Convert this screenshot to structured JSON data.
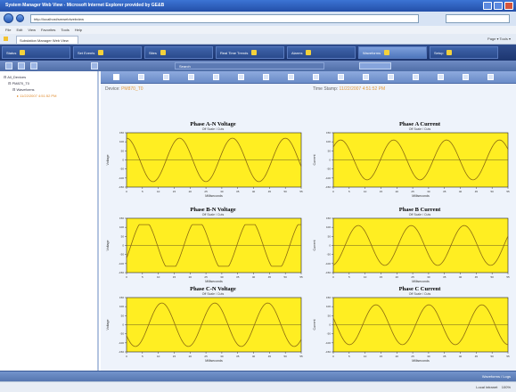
{
  "window": {
    "title": "System Manager Web View - Microsoft Internet Explorer provided by GE&B"
  },
  "browser": {
    "url": "http://localhost/smweb/webview",
    "menu": [
      "File",
      "Edit",
      "View",
      "Favorites",
      "Tools",
      "Help"
    ],
    "tab_title": "Substation Manager Web View",
    "command_labels": "Page ▾   Tools ▾",
    "status_text": "Local intranet",
    "zoom": "100%"
  },
  "app_nav": {
    "items": [
      {
        "label": "Status",
        "icon": "status-icon"
      },
      {
        "label": "Set Events",
        "icon": "event-icon"
      },
      {
        "label": "Sites",
        "icon": "sites-icon"
      },
      {
        "label": "Real Time Trends",
        "icon": "trend-icon"
      },
      {
        "label": "Alarms",
        "icon": "alarm-icon"
      },
      {
        "label": "Waveforms",
        "icon": "waveform-icon"
      },
      {
        "label": "Setup",
        "icon": "setup-icon"
      }
    ],
    "active": "Waveforms"
  },
  "toolbar": {
    "field_1": "Search"
  },
  "tree": {
    "nodes": [
      {
        "label": "All_Devices",
        "level": 0
      },
      {
        "label": "PM870_T0",
        "level": 1
      },
      {
        "label": "Waveforms",
        "level": 2
      },
      {
        "label": "11/22/2007 4:51:52 PM",
        "level": 3,
        "selected": true
      }
    ]
  },
  "main": {
    "device_label": "Device:",
    "device_value": "PM870_T0",
    "time_label": "Time Stamp:",
    "time_value": "11/22/2007 4:51:52 PM"
  },
  "status": {
    "right_text": "Waveforms / Logs"
  },
  "colors": {
    "plot_bg": "#ffee22",
    "wave": "#8a6a10",
    "nav_bg": "#1d3670",
    "accent": "#e39a3a"
  },
  "chart_data": [
    {
      "type": "line",
      "title": "Phase A-N Voltage",
      "subtitle": "Off Scale / Cuts",
      "xlabel": "Milliseconds",
      "ylabel": "Voltage",
      "xlim": [
        0,
        55
      ],
      "ylim": [
        -150,
        150
      ],
      "xticks": [
        0,
        5,
        10,
        15,
        20,
        25,
        30,
        35,
        40,
        45,
        50,
        55
      ],
      "yticks": [
        -150,
        -100,
        -50,
        0,
        50,
        100,
        150
      ],
      "cycles": 3.3,
      "amplitude": 120,
      "phase_deg": 90,
      "clip": null
    },
    {
      "type": "line",
      "title": "Phase A Current",
      "subtitle": "Off Scale / Cuts",
      "xlabel": "Milliseconds",
      "ylabel": "Current",
      "xlim": [
        0,
        55
      ],
      "ylim": [
        -150,
        150
      ],
      "xticks": [
        0,
        5,
        10,
        15,
        20,
        25,
        30,
        35,
        40,
        45,
        50,
        55
      ],
      "yticks": [
        -150,
        -100,
        -50,
        0,
        50,
        100,
        150
      ],
      "cycles": 3.3,
      "amplitude": 110,
      "phase_deg": 40,
      "clip": null
    },
    {
      "type": "line",
      "title": "Phase B-N Voltage",
      "subtitle": "Off Scale / Cuts",
      "xlabel": "Milliseconds",
      "ylabel": "Voltage",
      "xlim": [
        0,
        55
      ],
      "ylim": [
        -150,
        150
      ],
      "xticks": [
        0,
        5,
        10,
        15,
        20,
        25,
        30,
        35,
        40,
        45,
        50,
        55
      ],
      "yticks": [
        -150,
        -100,
        -50,
        0,
        50,
        100,
        150
      ],
      "cycles": 3.3,
      "amplitude": 140,
      "phase_deg": -30,
      "clip": 115
    },
    {
      "type": "line",
      "title": "Phase B Current",
      "subtitle": "Off Scale / Cuts",
      "xlabel": "Milliseconds",
      "ylabel": "Current",
      "xlim": [
        0,
        55
      ],
      "ylim": [
        -150,
        150
      ],
      "xticks": [
        0,
        5,
        10,
        15,
        20,
        25,
        30,
        35,
        40,
        45,
        50,
        55
      ],
      "yticks": [
        -150,
        -100,
        -50,
        0,
        50,
        100,
        150
      ],
      "cycles": 3.3,
      "amplitude": 110,
      "phase_deg": -80,
      "clip": null
    },
    {
      "type": "line",
      "title": "Phase C-N Voltage",
      "subtitle": "Off Scale / Cuts",
      "xlabel": "Milliseconds",
      "ylabel": "Voltage",
      "xlim": [
        0,
        55
      ],
      "ylim": [
        -150,
        150
      ],
      "xticks": [
        0,
        5,
        10,
        15,
        20,
        25,
        30,
        35,
        40,
        45,
        50,
        55
      ],
      "yticks": [
        -150,
        -100,
        -50,
        0,
        50,
        100,
        150
      ],
      "cycles": 3.3,
      "amplitude": 120,
      "phase_deg": 210,
      "clip": null
    },
    {
      "type": "line",
      "title": "Phase C Current",
      "subtitle": "Off Scale / Cuts",
      "xlabel": "Milliseconds",
      "ylabel": "Current",
      "xlim": [
        0,
        55
      ],
      "ylim": [
        -150,
        150
      ],
      "xticks": [
        0,
        5,
        10,
        15,
        20,
        25,
        30,
        35,
        40,
        45,
        50,
        55
      ],
      "yticks": [
        -150,
        -100,
        -50,
        0,
        50,
        100,
        150
      ],
      "cycles": 3.3,
      "amplitude": 110,
      "phase_deg": 160,
      "clip": null
    }
  ]
}
